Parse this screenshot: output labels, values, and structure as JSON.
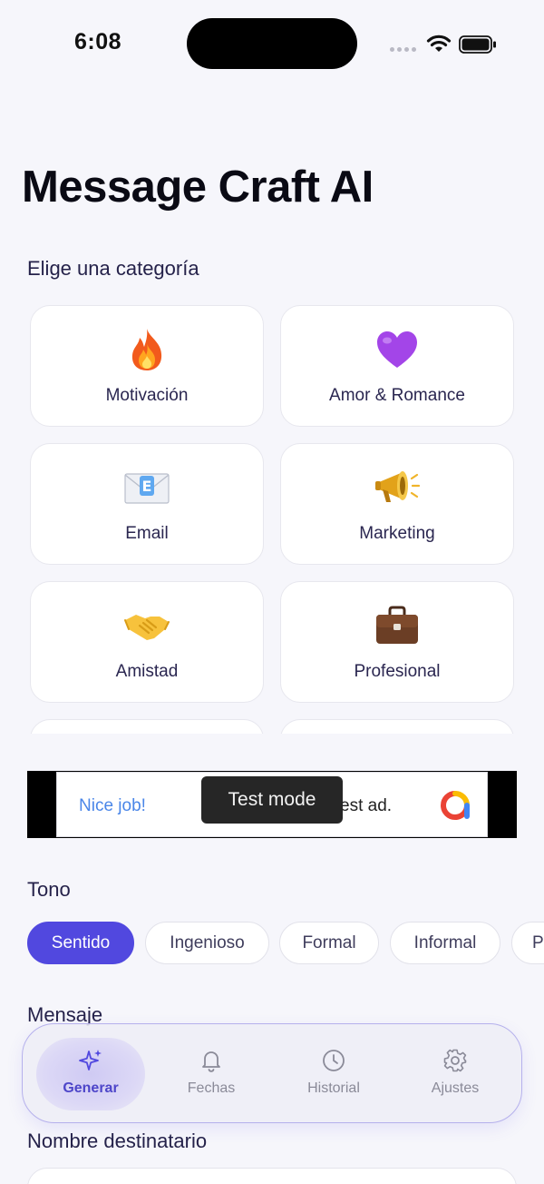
{
  "status_bar": {
    "time": "6:08"
  },
  "header": {
    "title": "Message Craft AI"
  },
  "category_section": {
    "label": "Elige una categoría"
  },
  "categories": [
    {
      "label": "Motivación",
      "icon": "fire-icon"
    },
    {
      "label": "Amor & Romance",
      "icon": "purple-heart-icon"
    },
    {
      "label": "Email",
      "icon": "envelope-icon"
    },
    {
      "label": "Marketing",
      "icon": "megaphone-icon"
    },
    {
      "label": "Amistad",
      "icon": "handshake-icon"
    },
    {
      "label": "Profesional",
      "icon": "briefcase-icon"
    }
  ],
  "ad": {
    "left_text": "Nice job!",
    "right_text": "est ad.",
    "toast": "Test mode"
  },
  "tone_section": {
    "label": "Tono",
    "options": [
      "Sentido",
      "Ingenioso",
      "Formal",
      "Informal",
      "P"
    ],
    "selected": "Sentido"
  },
  "message_section": {
    "label": "Mensaje"
  },
  "recipient_section": {
    "label": "Nombre destinatario"
  },
  "tab_bar": {
    "tabs": [
      {
        "label": "Generar",
        "icon": "sparkles-icon",
        "active": true
      },
      {
        "label": "Fechas",
        "icon": "bell-icon",
        "active": false
      },
      {
        "label": "Historial",
        "icon": "clock-icon",
        "active": false
      },
      {
        "label": "Ajustes",
        "icon": "gear-icon",
        "active": false
      }
    ]
  },
  "colors": {
    "accent": "#5148DF",
    "background": "#F6F6FB",
    "ad_link": "#4A86E8"
  }
}
